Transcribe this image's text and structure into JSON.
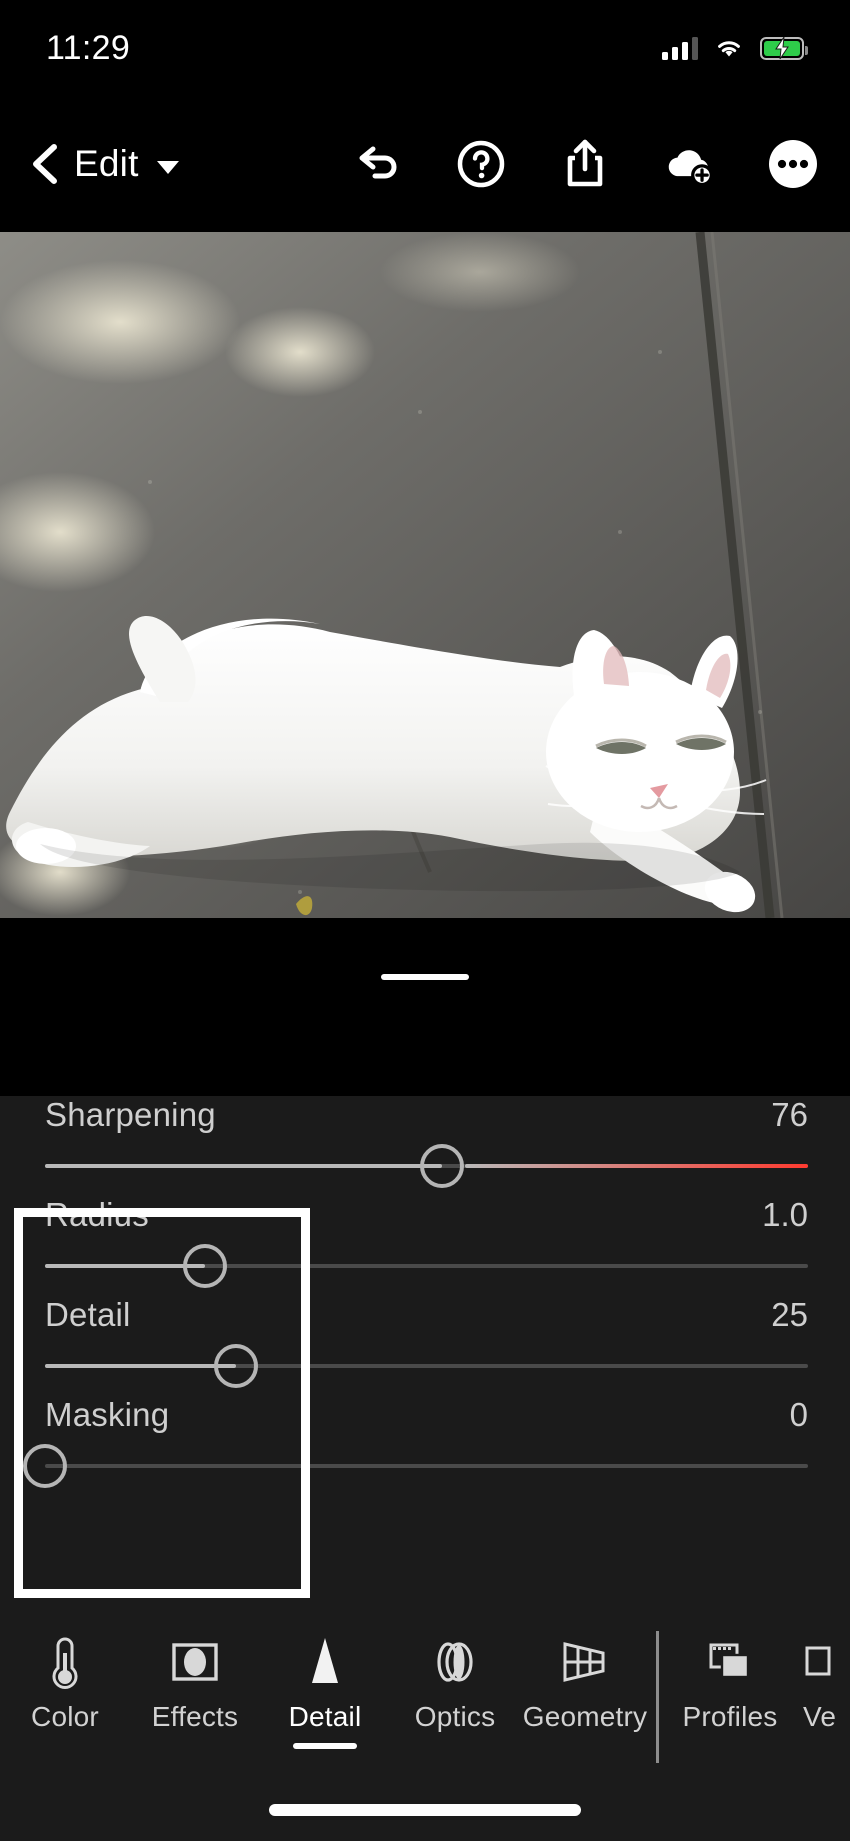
{
  "status_bar": {
    "time": "11:29",
    "signal_icon": "cellular-bars-icon",
    "wifi_icon": "wifi-icon",
    "battery_icon": "battery-charging-icon",
    "battery_color": "#2ecc4a"
  },
  "top_nav": {
    "back_icon": "chevron-left-icon",
    "title": "Edit",
    "title_caret_icon": "caret-down-icon",
    "actions": [
      {
        "name": "undo-button",
        "icon": "undo-arrow-icon"
      },
      {
        "name": "help-button",
        "icon": "question-circle-icon"
      },
      {
        "name": "share-button",
        "icon": "share-upload-icon"
      },
      {
        "name": "cloud-add-button",
        "icon": "cloud-plus-icon"
      },
      {
        "name": "more-button",
        "icon": "ellipsis-circle-icon"
      }
    ]
  },
  "photo": {
    "subject": "white cat lying on concrete sidewalk",
    "grabber_icon": "drag-handle-icon"
  },
  "panel": {
    "background": "#1b1b1b",
    "sliders": [
      {
        "name": "sharpening",
        "label": "Sharpening",
        "value": "76",
        "percent": 52,
        "has_red_zone": true
      },
      {
        "name": "radius",
        "label": "Radius",
        "value": "1.0",
        "percent": 21,
        "has_red_zone": false
      },
      {
        "name": "detail",
        "label": "Detail",
        "value": "25",
        "percent": 25,
        "has_red_zone": false
      },
      {
        "name": "masking",
        "label": "Masking",
        "value": "0",
        "percent": 0,
        "has_red_zone": false
      }
    ]
  },
  "highlight": {
    "name": "highlight-rectangle",
    "color": "#ffffff",
    "covers": "Radius, Detail and Masking slider labels"
  },
  "tab_bar": {
    "tabs": [
      {
        "label": "Color",
        "icon": "thermometer-icon",
        "active": false
      },
      {
        "label": "Effects",
        "icon": "vignette-frame-icon",
        "active": false
      },
      {
        "label": "Detail",
        "icon": "triangle-detail-icon",
        "active": true
      },
      {
        "label": "Optics",
        "icon": "lens-icon",
        "active": false
      },
      {
        "label": "Geometry",
        "icon": "perspective-grid-icon",
        "active": false
      },
      {
        "label": "Profiles",
        "icon": "stacked-photos-icon",
        "active": false
      },
      {
        "label": "Ve",
        "icon": "versions-icon",
        "active": false
      }
    ]
  },
  "home_indicator": {
    "name": "home-indicator"
  }
}
